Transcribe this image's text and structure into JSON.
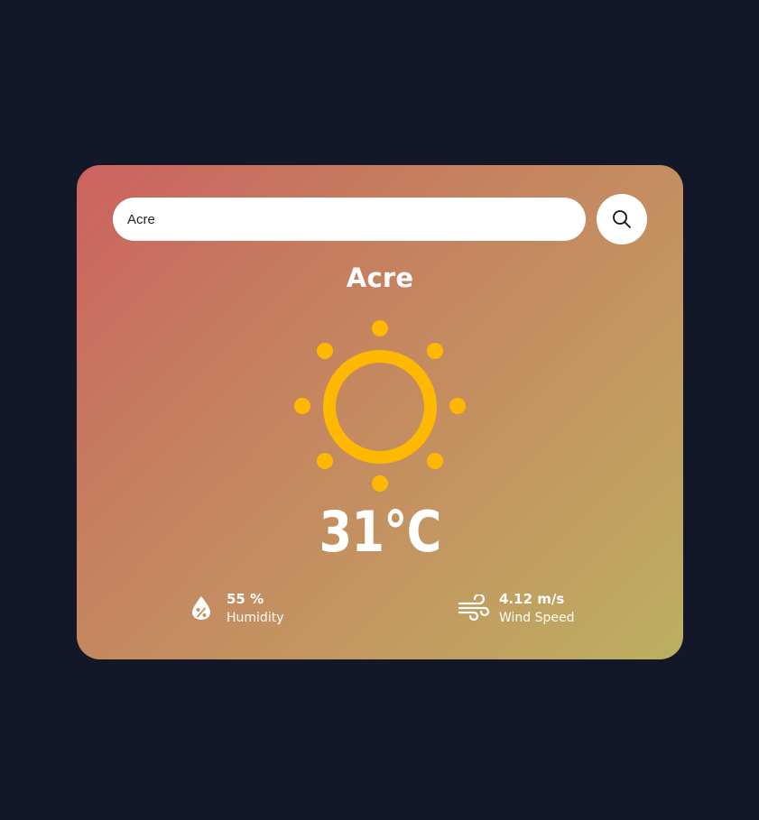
{
  "search": {
    "value": "Acre",
    "icon": "search-icon"
  },
  "weather": {
    "city": "Acre",
    "condition_icon": "sun-icon",
    "temperature": "31°C"
  },
  "stats": {
    "humidity": {
      "value": "55 %",
      "label": "Humidity",
      "icon": "humidity-icon"
    },
    "wind": {
      "value": "4.12 m/s",
      "label": "Wind Speed",
      "icon": "wind-icon"
    }
  },
  "colors": {
    "background": "#121827",
    "sun": "#FFB800",
    "card_gradient_start": "#cc6260",
    "card_gradient_end": "#bcb060",
    "text": "#ffffff"
  }
}
